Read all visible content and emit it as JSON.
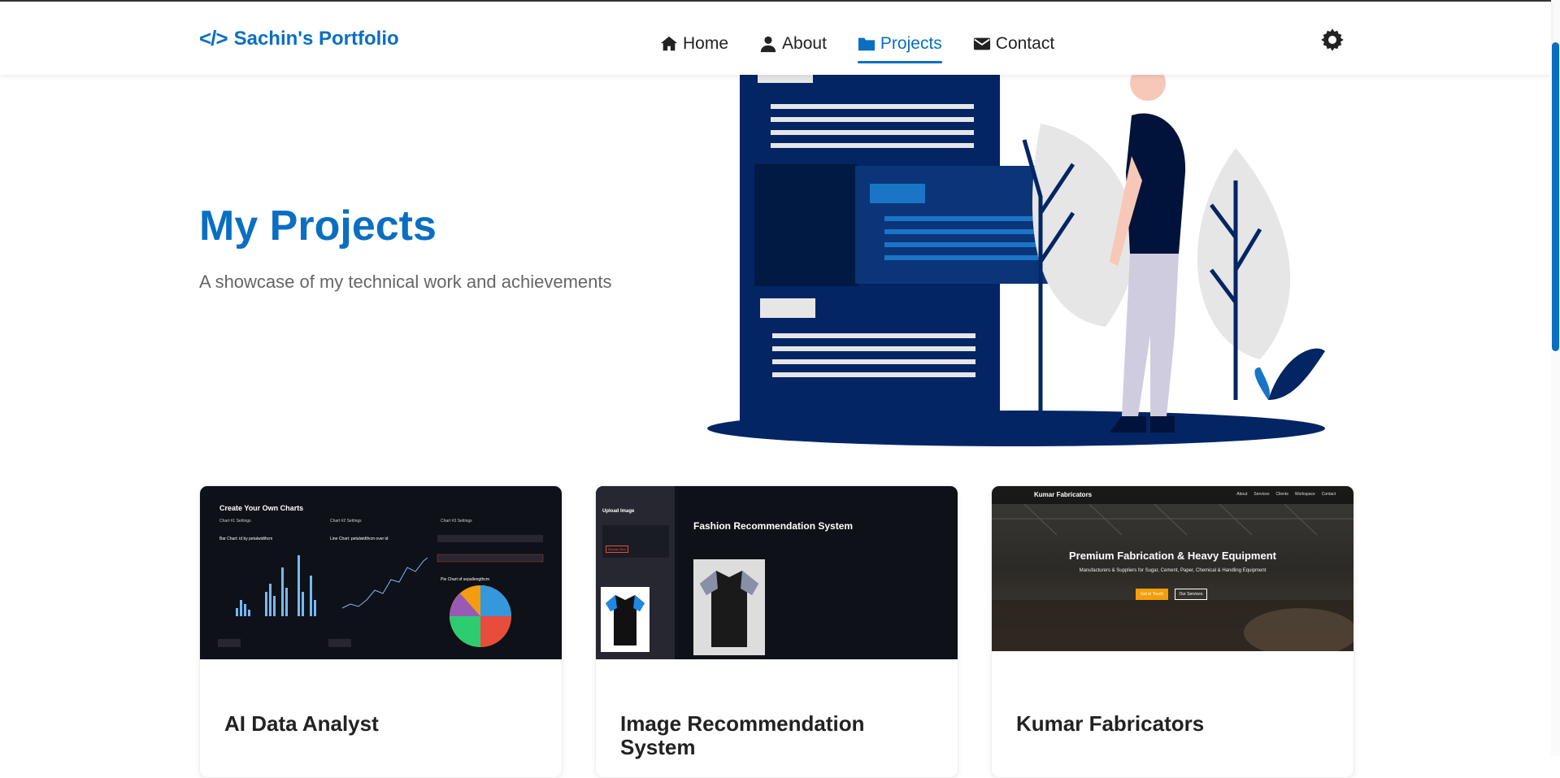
{
  "brand": {
    "icon": "</>",
    "name": "Sachin's Portfolio"
  },
  "nav": [
    {
      "label": "Home",
      "icon": "home-icon"
    },
    {
      "label": "About",
      "icon": "user-icon"
    },
    {
      "label": "Projects",
      "icon": "folder-icon",
      "active": true
    },
    {
      "label": "Contact",
      "icon": "envelope-icon"
    }
  ],
  "theme_toggle": {
    "icon": "gear-icon"
  },
  "hero": {
    "title": "My Projects",
    "subtitle": "A showcase of my technical work and achievements"
  },
  "projects": [
    {
      "title": "AI Data Analyst",
      "thumb": {
        "heading": "Create Your Own Charts",
        "settings": [
          "Chart #1 Settings",
          "Chart #2 Settings",
          "Chart #3 Settings"
        ],
        "chart_titles": [
          "Bar Chart: id by petalwidthcm",
          "Line Chart: petalwidthcm over id",
          "Pie Chart of sepallengthcm"
        ],
        "remove_label": "Remove"
      }
    },
    {
      "title": "Image Recommendation System",
      "thumb": {
        "heading": "Fashion Recommendation System",
        "upload_title": "Upload Image",
        "browse": "Browse files"
      }
    },
    {
      "title": "Kumar Fabricators",
      "thumb": {
        "logo": "Kumar Fabricators",
        "links": [
          "About",
          "Services",
          "Clients",
          "Workspace",
          "Contact"
        ],
        "heading": "Premium Fabrication & Heavy Equipment",
        "sub": "Manufacturers & Suppliers for Sugar, Cement, Paper, Chemical & Handling Equipment",
        "btn1": "Get in Touch",
        "btn2": "Our Services"
      }
    }
  ],
  "colors": {
    "accent": "#0a6fc2",
    "navy": "#032564"
  }
}
